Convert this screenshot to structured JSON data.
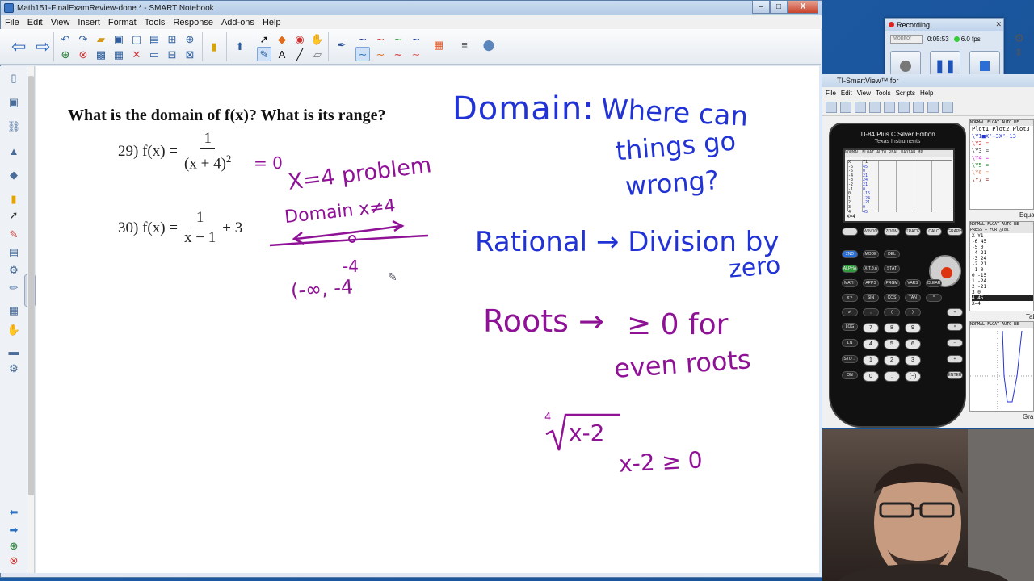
{
  "window": {
    "title": "Math151-FinalExamReview-done * - SMART Notebook",
    "controls": {
      "minimize": "–",
      "maximize": "□",
      "close": "X"
    }
  },
  "menu": [
    "File",
    "Edit",
    "View",
    "Insert",
    "Format",
    "Tools",
    "Response",
    "Add-ons",
    "Help"
  ],
  "toolbar": {
    "back_icon": "arrow-left-icon",
    "forward_icon": "arrow-right-icon",
    "tools": [
      "undo-icon",
      "redo-icon",
      "open-icon",
      "screenshade-icon",
      "print-icon",
      "document-camera-icon",
      "table-icon",
      "screen-capture-icon",
      "delete-icon",
      "select-icon",
      "fill-icon",
      "eraser-icon",
      "pen-icon",
      "text-icon",
      "line-icon",
      "shapes-icon"
    ]
  },
  "page": {
    "question": "What is the domain of f(x)? What is its range?",
    "problems": [
      {
        "label": "29) f(x) =",
        "num": "1",
        "den": "(x + 4)",
        "den_sup": "2"
      },
      {
        "label": "30) f(x) =",
        "num": "1",
        "den": "x − 1",
        "suffix": "+ 3"
      }
    ],
    "ink": {
      "eq_zero": "= 0",
      "x4_problem": "X=4  problem",
      "domain_x": "Domain  x≠4",
      "neg4": "-4",
      "interval": "(-∞, -4",
      "domain_title": "Domain:",
      "where": "Where can",
      "things": "things go",
      "wrong": "wrong?",
      "rational": "Rational → Division by",
      "zero": "zero",
      "roots": "Roots →",
      "geq": "≥ 0  for",
      "even_roots": "even roots",
      "radical_index": "4",
      "radicand": "x-2",
      "ineq": "x-2 ≥ 0"
    }
  },
  "recording": {
    "title": "Recording...",
    "source": "Monitor",
    "time": "0:05:53",
    "fps": "6.0 fps"
  },
  "ti": {
    "title": "TI-SmartView™ for",
    "menu": [
      "File",
      "Edit",
      "View",
      "Tools",
      "Scripts",
      "Help"
    ],
    "brand": "TI-84 Plus C Silver Edition",
    "brand2": "Texas Instruments",
    "lcd_header": "NORMAL FLOAT AUTO REAL RADIAN MP",
    "lcd_sub": "PRESS + FOR △Tbl",
    "lcd_cols": [
      "X",
      "Y1"
    ],
    "lcd_x": [
      "-6",
      "-5",
      "-4",
      "-3",
      "-2",
      "-1",
      "0",
      "1",
      "2",
      "3",
      "4"
    ],
    "lcd_y": [
      "45",
      "0",
      "21",
      "24",
      "21",
      "0",
      "-15",
      "-24",
      "-21",
      "0",
      "45"
    ],
    "lcd_bottom": "X=4",
    "keys_top": [
      "ZOOM",
      "WINDOW",
      "TRACE",
      "CALC",
      "GRAPH"
    ],
    "keys": [
      "2ND",
      "MODE",
      "DEL",
      "ALPHA",
      "X,T,θ,n",
      "STAT",
      "MATH",
      "APPS",
      "PRGM",
      "VARS",
      "CLEAR",
      "x⁻¹",
      "SIN",
      "COS",
      "TAN",
      "^",
      "x²",
      ",",
      "(",
      ")",
      "÷",
      "LOG",
      "7",
      "8",
      "9",
      "×",
      "LN",
      "4",
      "5",
      "6",
      "−",
      "STO→",
      "1",
      "2",
      "3",
      "+",
      "ON",
      "0",
      ".",
      "(−)",
      "ENTER"
    ],
    "eq_panel": {
      "header": "NORMAL FLOAT AUTO RE",
      "plots": "Plot1  Plot2  Plot3",
      "y1": "\\Y1■X²+3X²-13",
      "rows": [
        "\\Y2 =",
        "\\Y3 =",
        "\\Y4 =",
        "\\Y5 =",
        "\\Y6 =",
        "\\Y7 ="
      ],
      "caption": "Equa"
    },
    "tbl_panel": {
      "header": "NORMAL FLOAT AUTO RE",
      "sub": "PRESS + FOR △Tbl",
      "cols": "X    Y1",
      "rows": [
        "-6   45",
        "-5   0",
        "-4   21",
        "-3   24",
        "-2   21",
        "-1   0",
        "0    -15",
        "1    -24",
        "2    -21",
        "3    0",
        "4    45"
      ],
      "bottom": "X=4",
      "caption": "Tab"
    },
    "graph_panel": {
      "header": "NORMAL FLOAT AUTO RE",
      "caption": "Gra"
    }
  }
}
